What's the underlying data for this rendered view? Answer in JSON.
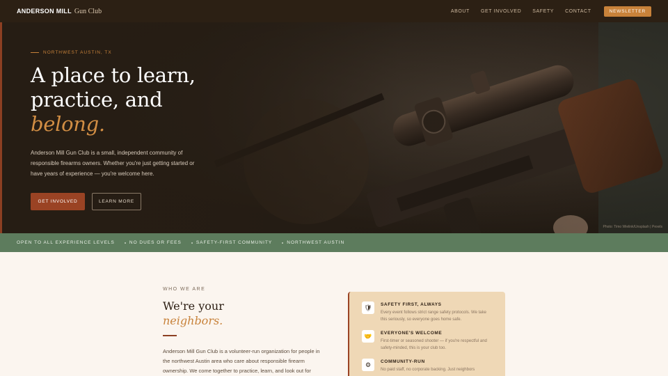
{
  "nav": {
    "brand_strong": "ANDERSON MILL",
    "brand_light": "Gun Club",
    "links": [
      "ABOUT",
      "GET INVOLVED",
      "SAFETY",
      "CONTACT"
    ],
    "cta": "NEWSLETTER"
  },
  "hero": {
    "eyebrow": "NORTHWEST AUSTIN, TX",
    "title_line1": "A place to learn,",
    "title_line2": "practice, and",
    "title_accent": "belong.",
    "description": "Anderson Mill Gun Club is a small, independent community of responsible firearms owners. Whether you're just getting started or have years of experience — you're welcome here.",
    "primary_button": "GET INVOLVED",
    "secondary_button": "LEARN MORE",
    "photo_credit": "Photo: Timo Wielink/Unsplash | Pexels"
  },
  "strip": {
    "items": [
      "OPEN TO ALL EXPERIENCE LEVELS",
      "NO DUES OR FEES",
      "SAFETY-FIRST COMMUNITY",
      "NORTHWEST AUSTIN"
    ]
  },
  "about": {
    "label": "WHO WE ARE",
    "title": "We're your",
    "title_accent": "neighbors.",
    "body": "Anderson Mill Gun Club is a volunteer-run organization for people in the northwest Austin area who care about responsible firearm ownership. We come together to practice, learn, and look out for"
  },
  "values": [
    {
      "icon": "shield-icon",
      "glyph": "🛡",
      "title": "SAFETY FIRST, ALWAYS",
      "desc": "Every event follows strict range safety protocols. We take this seriously, so everyone goes home safe."
    },
    {
      "icon": "handshake-icon",
      "glyph": "🤝",
      "title": "EVERYONE'S WELCOME",
      "desc": "First-timer or seasoned shooter — if you're respectful and safety-minded, this is your club too."
    },
    {
      "icon": "community-icon",
      "glyph": "⚙",
      "title": "COMMUNITY-RUN",
      "desc": "No paid staff, no corporate backing. Just neighbors"
    }
  ],
  "colors": {
    "accent": "#c8823a",
    "rust": "#9a4324",
    "nav_bg": "#2c2014",
    "strip_bg": "#5d7c5d",
    "card_bg": "#efd8b6"
  }
}
